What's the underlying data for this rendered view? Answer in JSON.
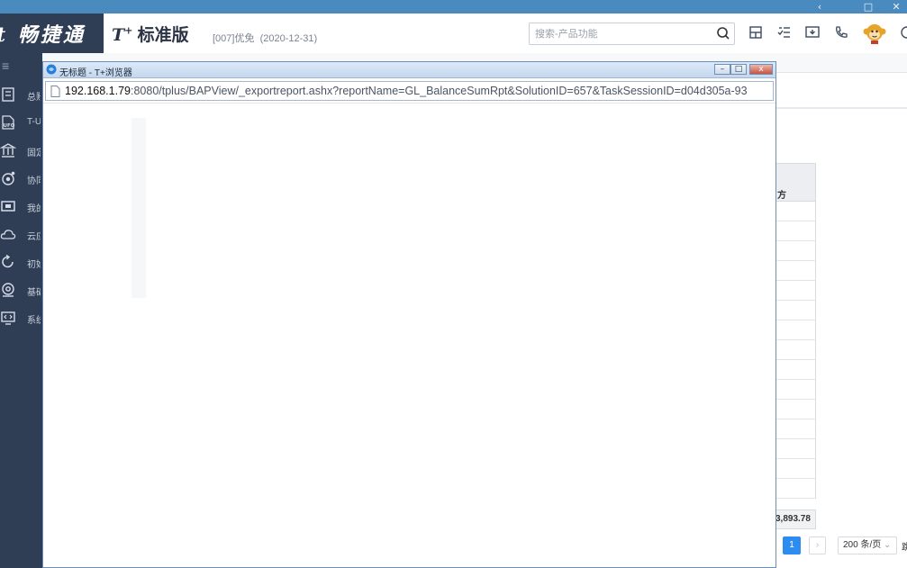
{
  "window": {
    "controls": [
      "‹",
      "□",
      "✕"
    ]
  },
  "header": {
    "brand": "畅捷通",
    "brand_prefix": "t",
    "product_prefix": "T",
    "product_sup": "+",
    "product_name": "标准版",
    "account_id": "[007]优免",
    "account_date": "(2020-12-31)",
    "search_placeholder": "搜索-产品功能"
  },
  "sidebar": {
    "top_glyph": "≡",
    "items": [
      {
        "label": "总账",
        "icon": "ledger-icon"
      },
      {
        "label": "T-UFO",
        "icon": "ufo-report-icon"
      },
      {
        "label": "固定资产",
        "icon": "bank-building-icon"
      },
      {
        "label": "协同",
        "icon": "collaboration-icon"
      },
      {
        "label": "我的",
        "icon": "monitor-icon"
      },
      {
        "label": "云应用",
        "icon": "cloud-icon"
      },
      {
        "label": "初始化",
        "icon": "refresh-icon"
      },
      {
        "label": "基础设置",
        "icon": "settings-icon"
      },
      {
        "label": "系统管理",
        "icon": "system-icon"
      }
    ]
  },
  "popup": {
    "title": "无标题 - T+浏览器",
    "url_host": "192.168.1.79",
    "url_rest": ":8080/tplus/BAPView/_exportreport.ashx?reportName=GL_BalanceSumRpt&SolutionID=657&TaskSessionID=d04d305a-93",
    "buttons": [
      "–",
      "□",
      "x"
    ]
  },
  "report": {
    "column_header_fragment": "方",
    "total_fragment": "3,893.78",
    "page_current": "1",
    "page_next": "›",
    "page_size": "200 条/页",
    "extra_fragment": "跳"
  },
  "colors": {
    "window_chrome": "#4a8bbf",
    "sidebar_bg": "#2f3d55",
    "accent_blue": "#2d8cf0",
    "mascot_orange": "#e8a32a"
  }
}
